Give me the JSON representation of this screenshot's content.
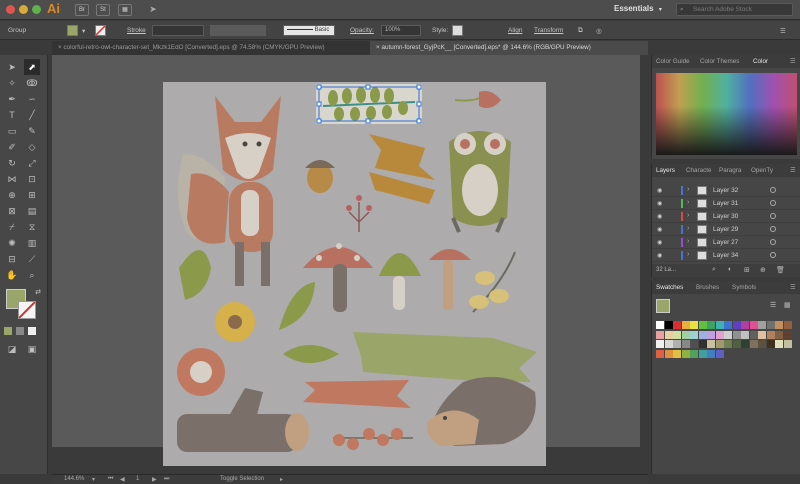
{
  "app": {
    "name": "Ai",
    "bridge_label": "Br",
    "stock_label": "St",
    "workspace": "Essentials",
    "search_placeholder": "Search Adobe Stock"
  },
  "control_bar": {
    "selection_label": "Group",
    "stroke_label": "Stroke",
    "brush_label": "Basic",
    "opacity_label": "Opacity:",
    "opacity_value": "100%",
    "style_label": "Style:",
    "align_label": "Align",
    "transform_label": "Transform",
    "fill_color": "#9aa56a"
  },
  "tabs": [
    {
      "label": "colorful-retro-owl-character-set_Mkzk1EdO [Converted].eps @ 74.58% (CMYK/GPU Preview)",
      "close": "×",
      "active": false
    },
    {
      "label": "autumn-forest_GyjPcK__ [Converted].eps* @ 144.6% (RGB/GPU Preview)",
      "close": "×",
      "active": true
    }
  ],
  "status_bar": {
    "zoom": "144.6%",
    "page": "1",
    "tool_hint": "Toggle Selection"
  },
  "color_panel": {
    "tabs": [
      "Color Guide",
      "Color Themes",
      "Color"
    ],
    "active_tab": "Color"
  },
  "layers_panel": {
    "tabs": [
      "Layers",
      "Characte",
      "Paragra",
      "OpenTy"
    ],
    "layers": [
      {
        "name": "Layer 32",
        "color": "#4a6fd8"
      },
      {
        "name": "Layer 31",
        "color": "#4cc24a"
      },
      {
        "name": "Layer 30",
        "color": "#d84a4a"
      },
      {
        "name": "Layer 29",
        "color": "#4a6fd8"
      },
      {
        "name": "Layer 27",
        "color": "#9a4ad8"
      },
      {
        "name": "Layer 34",
        "color": "#4a6fd8"
      }
    ],
    "count_label": "32 La..."
  },
  "swatches_panel": {
    "tabs": [
      "Swatches",
      "Brushes",
      "Symbols"
    ],
    "colors": [
      "#ffffff",
      "#000000",
      "#d83030",
      "#e8b040",
      "#e8e040",
      "#60c040",
      "#40a060",
      "#40b0b0",
      "#4070d0",
      "#6040c0",
      "#b040a0",
      "#e05090",
      "#a0a0a0",
      "#707070",
      "#c09060",
      "#906040",
      "#e8a0a0",
      "#e8d0a0",
      "#d0e0a0",
      "#a0d0a0",
      "#a0d0d0",
      "#a0b0e0",
      "#c0a0e0",
      "#e0a0d0",
      "#d0d0d0",
      "#909090",
      "#c0c0c0",
      "#606060",
      "#e0c0a0",
      "#b08060",
      "#806040",
      "#604030",
      "#f0f0f0",
      "#d8d8d8",
      "#b0b0b0",
      "#888888",
      "#505050",
      "#303030",
      "#c8c0a0",
      "#a09870",
      "#708050",
      "#506040",
      "#304030",
      "#807060",
      "#605040",
      "#403020",
      "#e0e0c0",
      "#c0c0a0",
      "#e06040",
      "#e09040",
      "#e0c040",
      "#90b040",
      "#50a060",
      "#40a0a0",
      "#4080c0",
      "#6060c0"
    ]
  }
}
